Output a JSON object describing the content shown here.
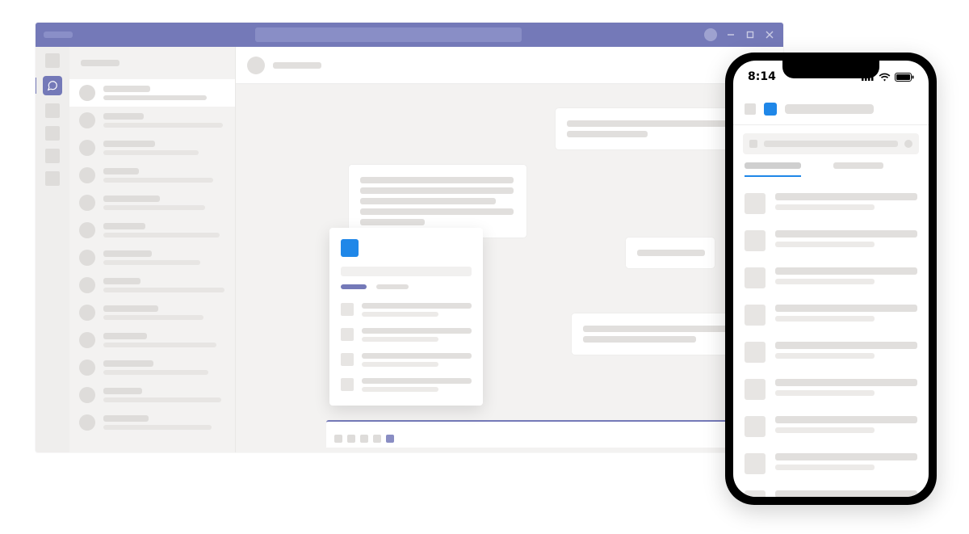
{
  "colors": {
    "accent": "#7479b8",
    "brandBlue": "#1f87e8"
  },
  "desktop": {
    "titlebar": {
      "appLabel": "",
      "searchPlaceholder": ""
    },
    "rail": {
      "items": [
        "",
        "",
        "",
        "",
        "",
        ""
      ]
    },
    "chatList": {
      "headerLabel": "",
      "items": [
        {
          "active": true
        },
        {
          "active": false
        },
        {
          "active": false
        },
        {
          "active": false
        },
        {
          "active": false
        },
        {
          "active": false
        },
        {
          "active": false
        },
        {
          "active": false
        },
        {
          "active": false
        },
        {
          "active": false
        },
        {
          "active": false
        },
        {
          "active": false
        },
        {
          "active": false
        }
      ]
    },
    "conversation": {
      "participantName": "",
      "messages": [
        {
          "side": "right",
          "lines": 2
        },
        {
          "side": "left",
          "lines": 5
        },
        {
          "side": "right",
          "lines": 1
        },
        {
          "side": "right",
          "lines": 2
        }
      ],
      "extensionPopup": {
        "appName": "",
        "searchPlaceholder": "",
        "tabs": [
          {
            "label": "",
            "active": true
          },
          {
            "label": "",
            "active": false
          }
        ],
        "results": [
          {
            "title": "",
            "subtitle": ""
          },
          {
            "title": "",
            "subtitle": ""
          },
          {
            "title": "",
            "subtitle": ""
          },
          {
            "title": "",
            "subtitle": ""
          }
        ]
      },
      "compose": {
        "icons": 5,
        "activeIcon": 4
      }
    }
  },
  "mobile": {
    "statusTime": "8:14",
    "header": {
      "appName": "",
      "title": ""
    },
    "searchPlaceholder": "",
    "tabs": [
      {
        "label": "",
        "active": true
      },
      {
        "label": "",
        "active": false
      }
    ],
    "results": [
      {
        "title": "",
        "subtitle": ""
      },
      {
        "title": "",
        "subtitle": ""
      },
      {
        "title": "",
        "subtitle": ""
      },
      {
        "title": "",
        "subtitle": ""
      },
      {
        "title": "",
        "subtitle": ""
      },
      {
        "title": "",
        "subtitle": ""
      },
      {
        "title": "",
        "subtitle": ""
      },
      {
        "title": "",
        "subtitle": ""
      },
      {
        "title": "",
        "subtitle": ""
      }
    ]
  }
}
